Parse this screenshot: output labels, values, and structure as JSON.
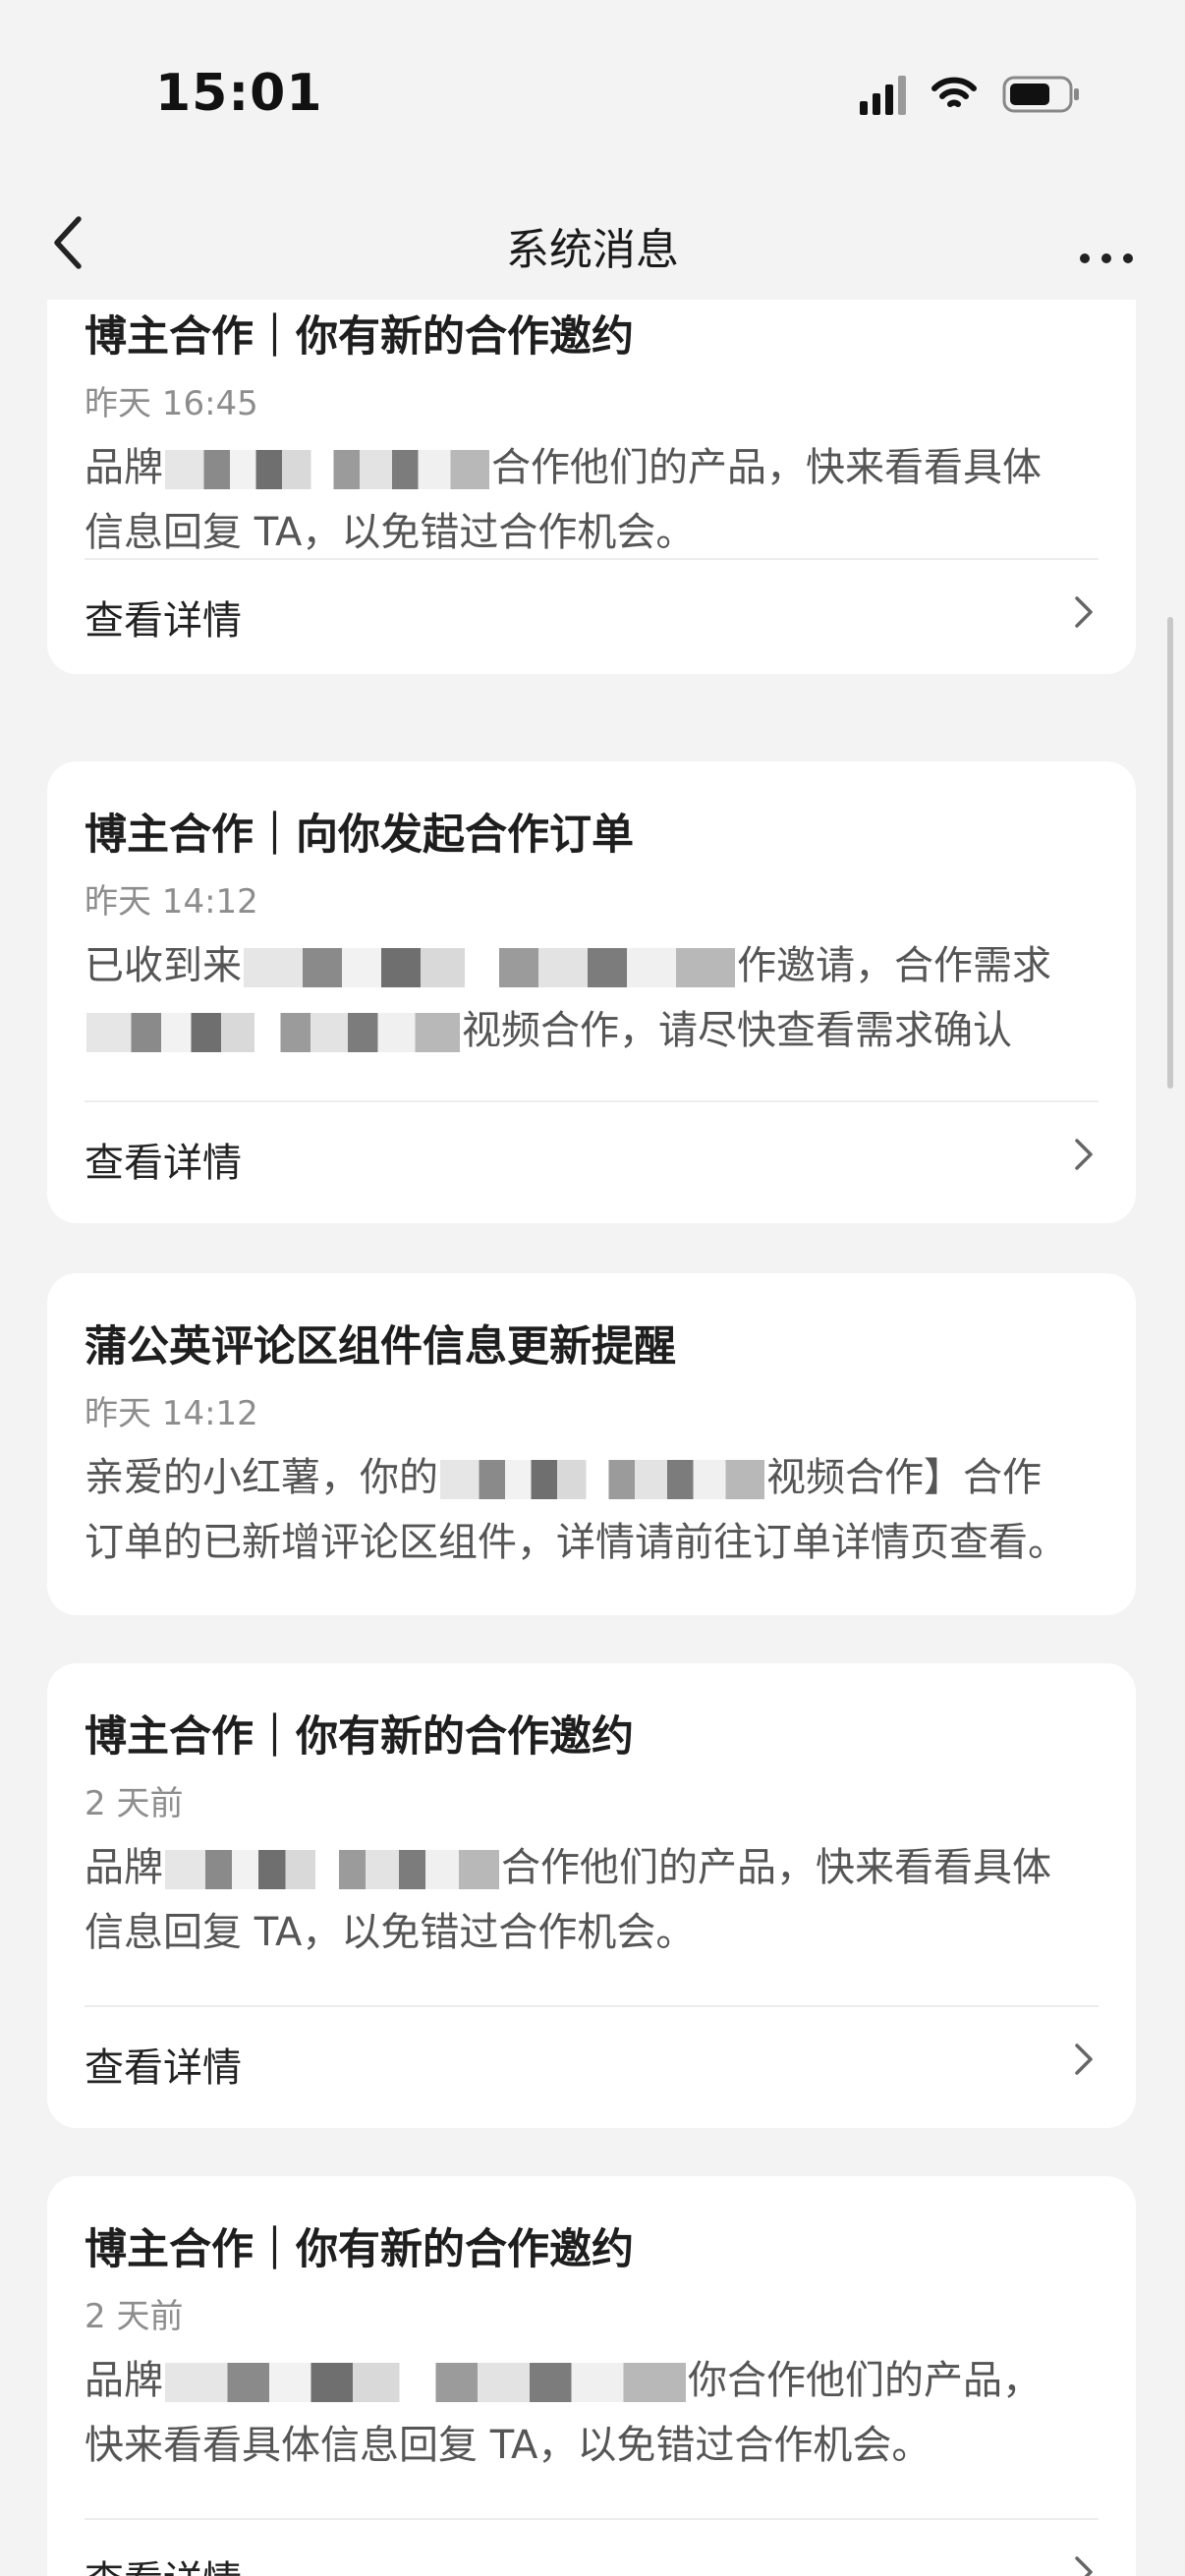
{
  "status_bar": {
    "time": "15:01"
  },
  "nav": {
    "title": "系统消息"
  },
  "messages": [
    {
      "title": "博主合作｜你有新的合作邀约",
      "time": "昨天 16:45",
      "lines": [
        {
          "pre": "品牌",
          "post": "合作他们的产品，快来看看具体"
        },
        {
          "pre": "信息回复 TA，以免错过合作机会。",
          "post": ""
        }
      ],
      "detail": "查看详情"
    },
    {
      "title": "博主合作｜向你发起合作订单",
      "time": "昨天 14:12",
      "lines": [
        {
          "pre": "已收到来",
          "post": "作邀请，合作需求"
        },
        {
          "pre": "",
          "post": "视频合作，请尽快查看需求确认"
        }
      ],
      "detail": "查看详情"
    },
    {
      "title": "蒲公英评论区组件信息更新提醒",
      "time": "昨天 14:12",
      "lines": [
        {
          "pre": "亲爱的小红薯，你的",
          "post": "视频合作】合作"
        },
        {
          "pre": "订单的已新增评论区组件，详情请前往订单详情页查看。",
          "post": ""
        }
      ],
      "detail": ""
    },
    {
      "title": "博主合作｜你有新的合作邀约",
      "time": "2 天前",
      "lines": [
        {
          "pre": "品牌",
          "post": "合作他们的产品，快来看看具体"
        },
        {
          "pre": "信息回复 TA，以免错过合作机会。",
          "post": ""
        }
      ],
      "detail": "查看详情"
    },
    {
      "title": "博主合作｜你有新的合作邀约",
      "time": "2 天前",
      "lines": [
        {
          "pre": "品牌",
          "post": "你合作他们的产品，"
        },
        {
          "pre": "快来看看具体信息回复 TA，以免错过合作机会。",
          "post": ""
        }
      ],
      "detail": "查看详情"
    }
  ]
}
